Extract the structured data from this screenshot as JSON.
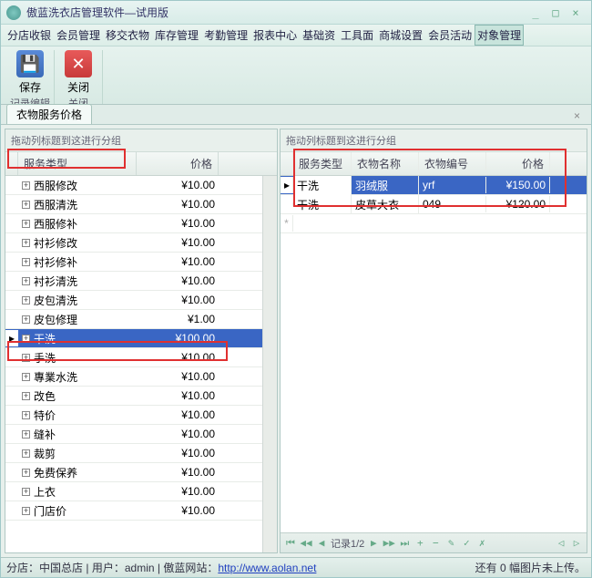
{
  "window": {
    "title": "傲蓝洗衣店管理软件—试用版"
  },
  "menu": {
    "items": [
      "分店收银",
      "会员管理",
      "移交衣物",
      "库存管理",
      "考勤管理",
      "报表中心",
      "基础资",
      "工具面",
      "商城设置",
      "会员活动",
      "对象管理"
    ],
    "active_index": 10
  },
  "toolbar": {
    "save_label": "保存",
    "close_label": "关闭",
    "group1": "记录编辑",
    "group2": "关闭"
  },
  "tab": {
    "label": "衣物服务价格"
  },
  "left_grid": {
    "group_hint": "拖动列标题到这进行分组",
    "columns": [
      "服务类型",
      "价格"
    ],
    "rows": [
      {
        "name": "西服修改",
        "price": "¥10.00"
      },
      {
        "name": "西服清洗",
        "price": "¥10.00"
      },
      {
        "name": "西服修补",
        "price": "¥10.00"
      },
      {
        "name": "衬衫修改",
        "price": "¥10.00"
      },
      {
        "name": "衬衫修补",
        "price": "¥10.00"
      },
      {
        "name": "衬衫清洗",
        "price": "¥10.00"
      },
      {
        "name": "皮包清洗",
        "price": "¥10.00"
      },
      {
        "name": "皮包修理",
        "price": "¥1.00"
      },
      {
        "name": "干洗",
        "price": "¥100.00",
        "selected": true
      },
      {
        "name": "手洗",
        "price": "¥10.00"
      },
      {
        "name": "專業水洗",
        "price": "¥10.00"
      },
      {
        "name": "改色",
        "price": "¥10.00"
      },
      {
        "name": "特价",
        "price": "¥10.00"
      },
      {
        "name": "缝补",
        "price": "¥10.00"
      },
      {
        "name": "裁剪",
        "price": "¥10.00"
      },
      {
        "name": "免费保养",
        "price": "¥10.00"
      },
      {
        "name": "上衣",
        "price": "¥10.00"
      },
      {
        "name": "门店价",
        "price": "¥10.00"
      }
    ]
  },
  "right_grid": {
    "group_hint": "拖动列标题到这进行分组",
    "columns": [
      "服务类型",
      "衣物名称",
      "衣物编号",
      "价格"
    ],
    "rows": [
      {
        "type": "干洗",
        "name": "羽绒服",
        "code": "yrf",
        "price": "¥150.00",
        "selected": true
      },
      {
        "type": "干洗",
        "name": "皮草大衣",
        "code": "049",
        "price": "¥120.00"
      }
    ],
    "nav_label": "记录1/2"
  },
  "status": {
    "branch_label": "分店：",
    "branch": "中国总店",
    "user_label": "用户：",
    "user": "admin",
    "site_label": "傲蓝网站：",
    "url": "http://www.aolan.net",
    "upload": "还有 0 幅图片未上传。"
  }
}
